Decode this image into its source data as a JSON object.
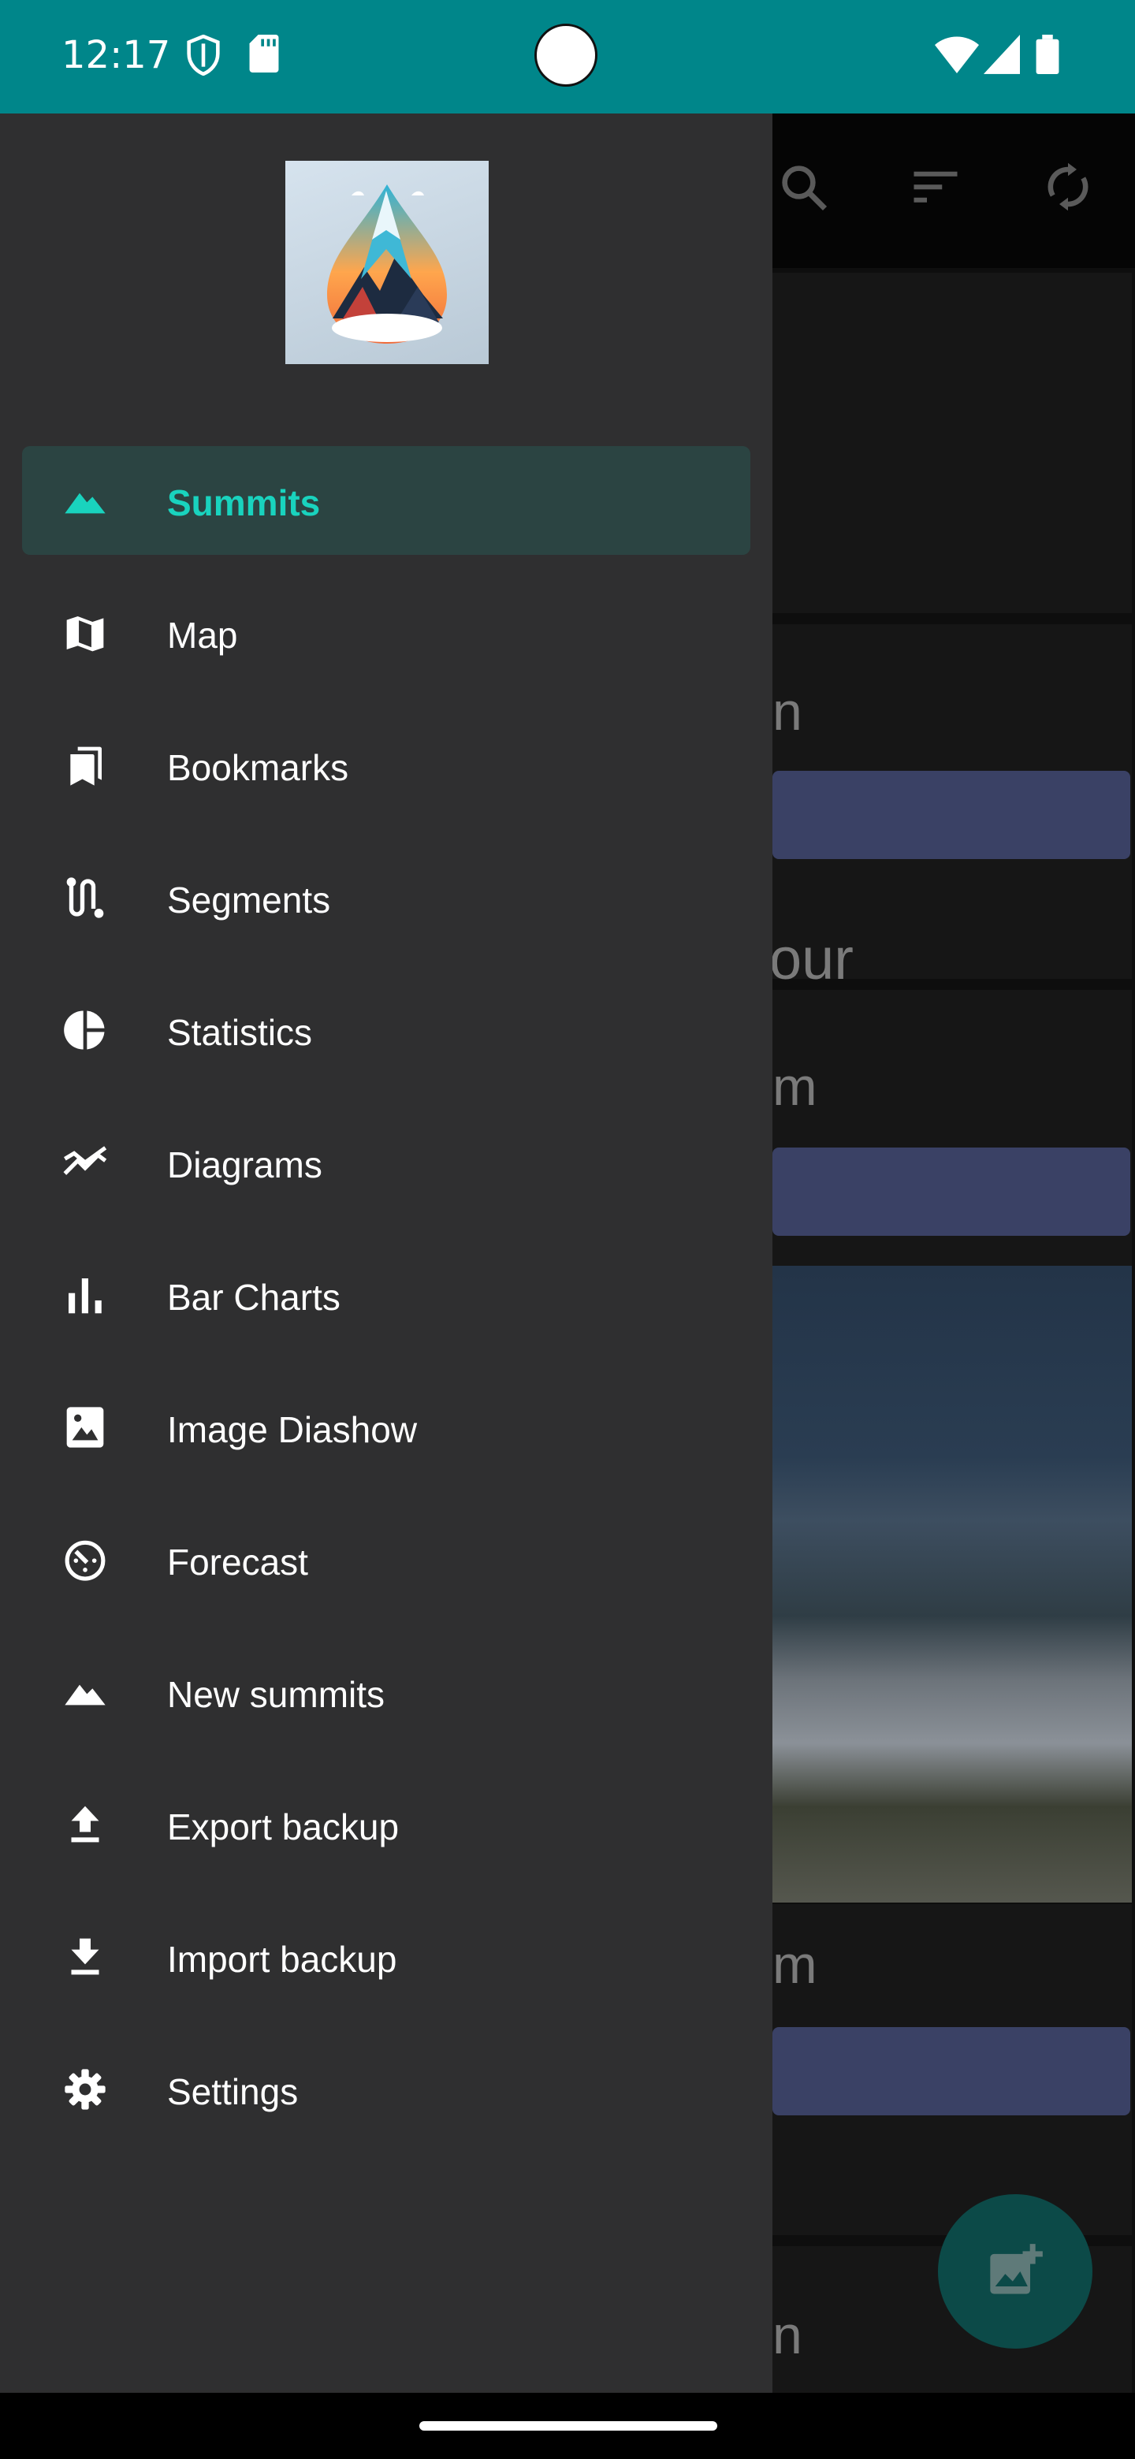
{
  "status_bar": {
    "time": "12:17",
    "left_icons": [
      "shield-icon",
      "sd-card-icon"
    ],
    "right_icons": [
      "wifi-icon",
      "signal-icon",
      "battery-icon"
    ]
  },
  "background_app": {
    "toolbar_icons": [
      "search-icon",
      "sort-icon",
      "sync-icon"
    ],
    "visible_text": [
      "n",
      "our",
      "m",
      "m",
      "n"
    ],
    "fab_icon": "add-photo-icon"
  },
  "drawer": {
    "logo": "app-logo-mountain",
    "items": [
      {
        "label": "Summits",
        "icon": "mountain-icon",
        "active": true
      },
      {
        "label": "Map",
        "icon": "map-icon",
        "active": false
      },
      {
        "label": "Bookmarks",
        "icon": "bookmarks-icon",
        "active": false
      },
      {
        "label": "Segments",
        "icon": "route-icon",
        "active": false
      },
      {
        "label": "Statistics",
        "icon": "pie-chart-icon",
        "active": false
      },
      {
        "label": "Diagrams",
        "icon": "line-chart-icon",
        "active": false
      },
      {
        "label": "Bar Charts",
        "icon": "bar-chart-icon",
        "active": false
      },
      {
        "label": "Image Diashow",
        "icon": "image-icon",
        "active": false
      },
      {
        "label": "Forecast",
        "icon": "timer-icon",
        "active": false
      },
      {
        "label": "New summits",
        "icon": "mountain-icon",
        "active": false
      },
      {
        "label": "Export backup",
        "icon": "upload-icon",
        "active": false
      },
      {
        "label": "Import backup",
        "icon": "download-icon",
        "active": false
      },
      {
        "label": "Settings",
        "icon": "gear-icon",
        "active": false
      }
    ]
  },
  "colors": {
    "status_bar": "#00868a",
    "drawer_bg": "#2f2f30",
    "active_item_bg": "#2b4442",
    "accent": "#19d3be",
    "chip": "#3a4165"
  }
}
